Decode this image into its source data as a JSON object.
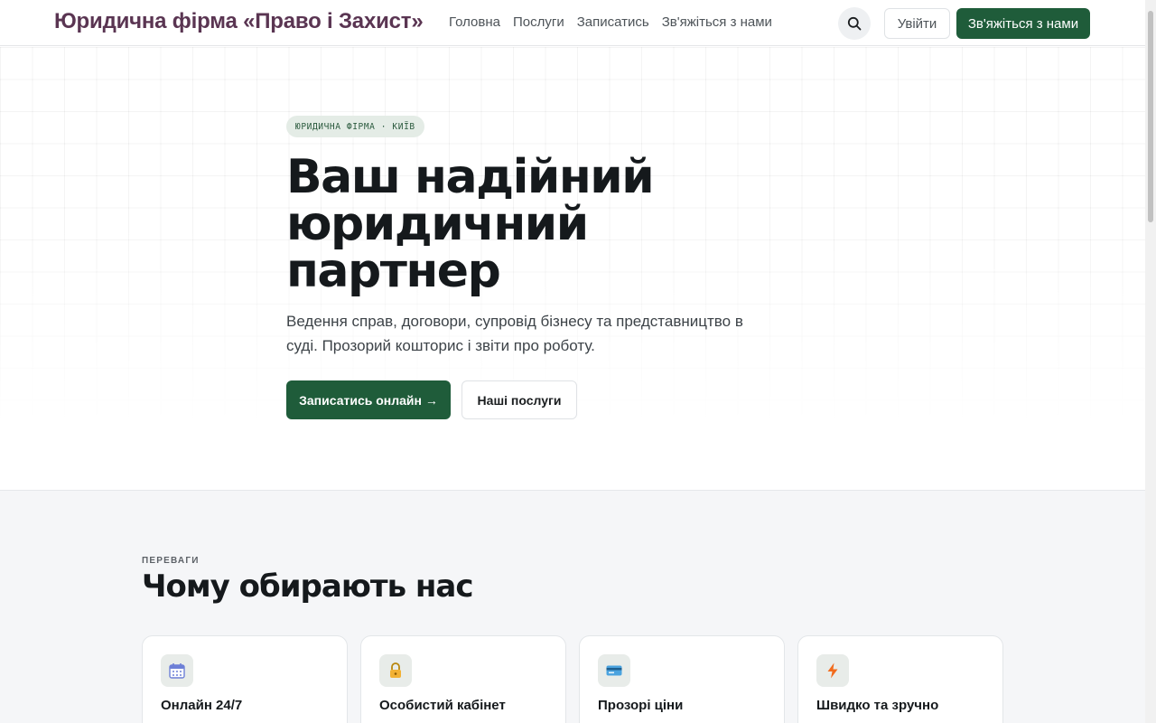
{
  "header": {
    "brand": "Юридична фірма «Право і Захист»",
    "nav": [
      "Головна",
      "Послуги",
      "Записатись",
      "Зв'яжіться з нами"
    ],
    "search_icon": "search-icon",
    "login_label": "Увійти",
    "contact_label": "Зв'яжіться з нами"
  },
  "hero": {
    "badge": "ЮРИДИЧНА ФІРМА · КИЇВ",
    "title": "Ваш надійний юридичний партнер",
    "subtitle": "Ведення справ, договори, супровід бізнесу та представництво в суді. Прозорий кошторис і звіти про роботу.",
    "primary_cta": "Записатись онлайн →",
    "secondary_cta": "Наші послуги"
  },
  "features": {
    "eyebrow": "ПЕРЕВАГИ",
    "title": "Чому обирають нас",
    "cards": [
      {
        "icon": "calendar-icon",
        "title": "Онлайн 24/7"
      },
      {
        "icon": "lock-icon",
        "title": "Особистий кабінет"
      },
      {
        "icon": "credit-card-icon",
        "title": "Прозорі ціни"
      },
      {
        "icon": "lightning-icon",
        "title": "Швидко та зручно"
      }
    ]
  },
  "colors": {
    "brand": "#5a3552",
    "accent": "#1f5c3a",
    "badge_bg": "#e4ece6"
  }
}
